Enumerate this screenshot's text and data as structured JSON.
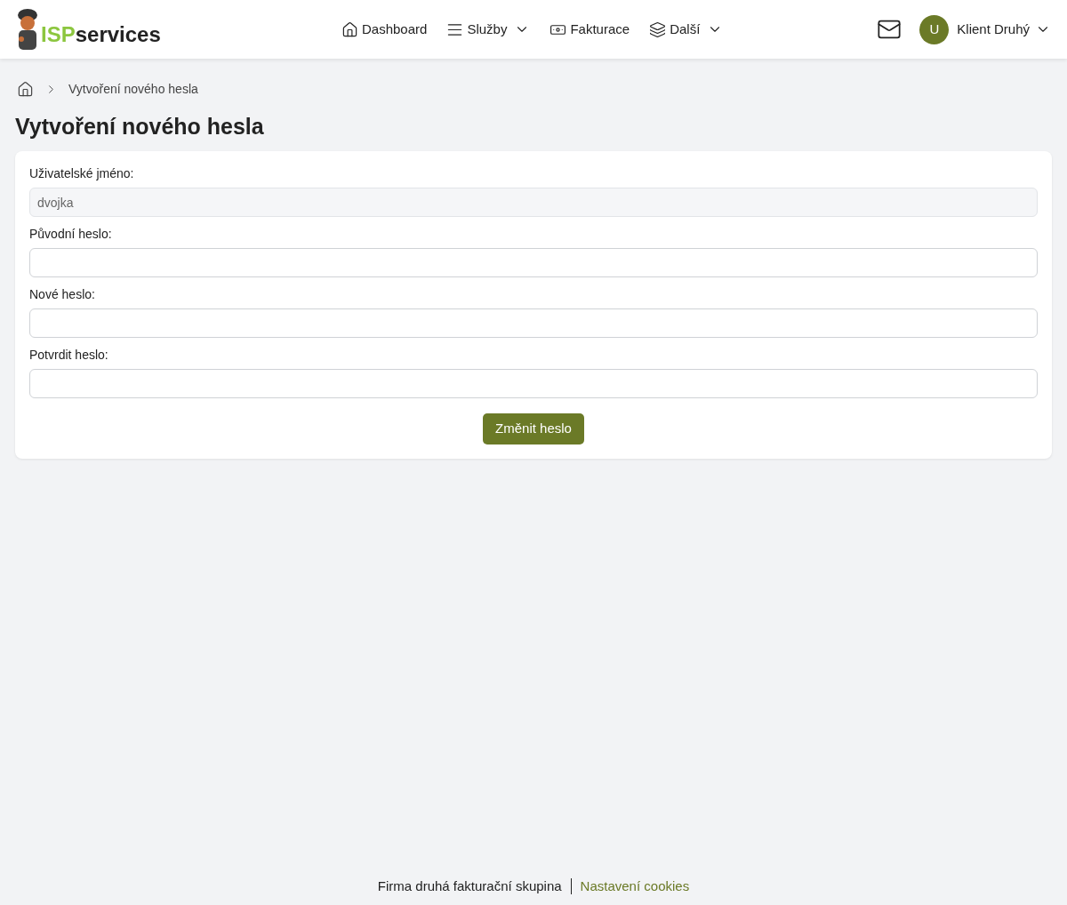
{
  "header": {
    "logo": {
      "prefix": "ISP",
      "suffix": "services"
    },
    "nav": [
      {
        "label": "Dashboard",
        "dropdown": false
      },
      {
        "label": "Služby",
        "dropdown": true
      },
      {
        "label": "Fakturace",
        "dropdown": false
      },
      {
        "label": "Další",
        "dropdown": true
      }
    ],
    "user": {
      "initial": "U",
      "name": "Klient Druhý"
    }
  },
  "breadcrumb": {
    "current": "Vytvoření nového hesla"
  },
  "title": "Vytvoření nového hesla",
  "form": {
    "fields": [
      {
        "label": "Uživatelské jméno:",
        "value": "dvojka",
        "disabled": true
      },
      {
        "label": "Původní heslo:",
        "disabled": false
      },
      {
        "label": "Nové heslo:",
        "disabled": false
      },
      {
        "label": "Potvrdit heslo:",
        "disabled": false
      }
    ],
    "submit": "Změnit heslo"
  },
  "footer": {
    "company": "Firma druhá fakturační skupina",
    "link": "Nastavení cookies"
  }
}
